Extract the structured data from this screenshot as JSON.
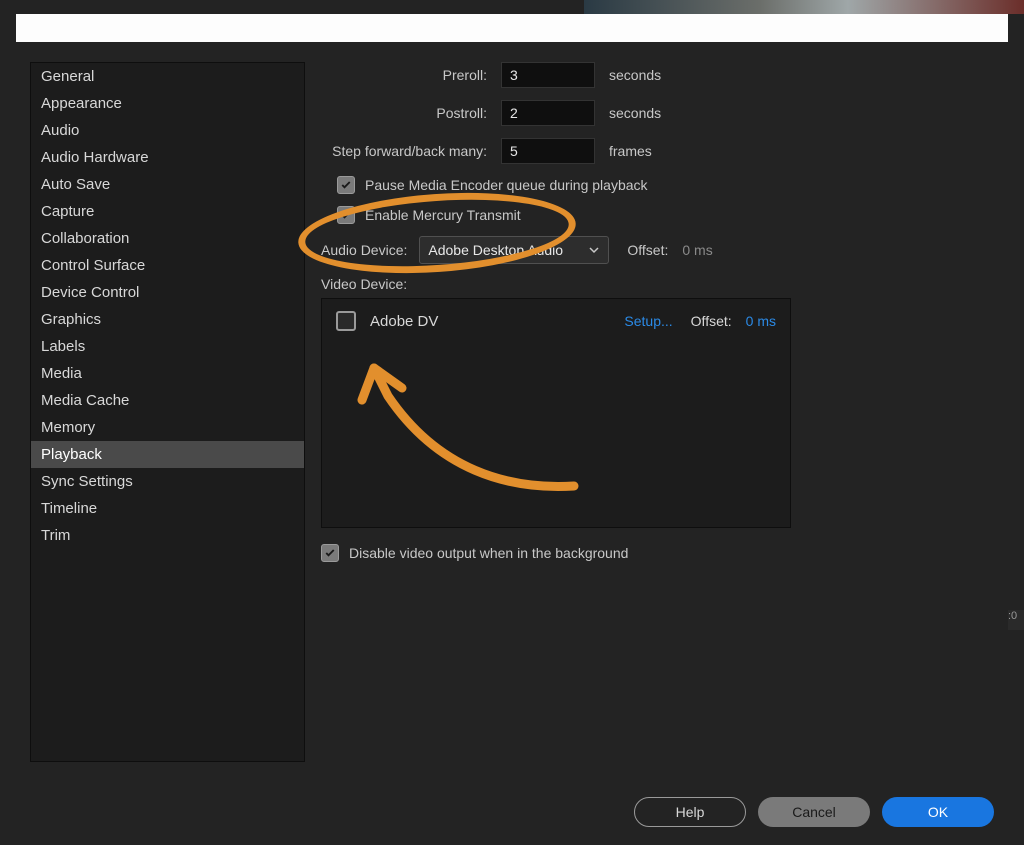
{
  "sidebar": {
    "items": [
      "General",
      "Appearance",
      "Audio",
      "Audio Hardware",
      "Auto Save",
      "Capture",
      "Collaboration",
      "Control Surface",
      "Device Control",
      "Graphics",
      "Labels",
      "Media",
      "Media Cache",
      "Memory",
      "Playback",
      "Sync Settings",
      "Timeline",
      "Trim"
    ],
    "selected_index": 14
  },
  "playback": {
    "preroll_label": "Preroll:",
    "preroll_value": "3",
    "preroll_unit": "seconds",
    "postroll_label": "Postroll:",
    "postroll_value": "2",
    "postroll_unit": "seconds",
    "step_label": "Step forward/back many:",
    "step_value": "5",
    "step_unit": "frames",
    "pause_encoder_label": "Pause Media Encoder queue during playback",
    "pause_encoder_checked": true,
    "mercury_label": "Enable Mercury Transmit",
    "mercury_checked": true,
    "audio_device_label": "Audio Device:",
    "audio_device_value": "Adobe Desktop Audio",
    "audio_offset_label": "Offset:",
    "audio_offset_value": "0 ms",
    "video_device_label": "Video Device:",
    "video_devices": [
      {
        "name": "Adobe DV",
        "checked": false,
        "setup": "Setup...",
        "offset_label": "Offset:",
        "offset_value": "0 ms"
      }
    ],
    "disable_bg_label": "Disable video output when in the background",
    "disable_bg_checked": true
  },
  "buttons": {
    "help": "Help",
    "cancel": "Cancel",
    "ok": "OK"
  },
  "annotation": {
    "color": "#e28f2d"
  },
  "bg": {
    "timecode_fragment": ":0"
  }
}
